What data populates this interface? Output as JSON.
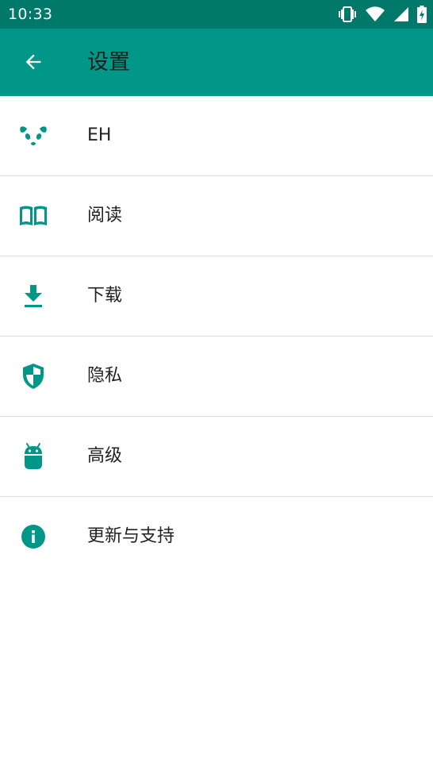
{
  "status_bar": {
    "time": "10:33",
    "icons": [
      "vibrate-icon",
      "wifi-icon",
      "signal-icon",
      "battery-charging-icon"
    ]
  },
  "app_bar": {
    "title": "设置",
    "back_icon": "arrow-back-icon"
  },
  "settings": {
    "items": [
      {
        "label": "EH",
        "icon": "panda-icon"
      },
      {
        "label": "阅读",
        "icon": "book-icon"
      },
      {
        "label": "下载",
        "icon": "download-icon"
      },
      {
        "label": "隐私",
        "icon": "shield-icon"
      },
      {
        "label": "高级",
        "icon": "android-icon"
      },
      {
        "label": "更新与支持",
        "icon": "info-icon"
      }
    ]
  },
  "colors": {
    "status_bar": "#00796b",
    "app_bar": "#009688",
    "accent": "#009688",
    "divider": "#dcdcdc",
    "text": "#222222"
  }
}
